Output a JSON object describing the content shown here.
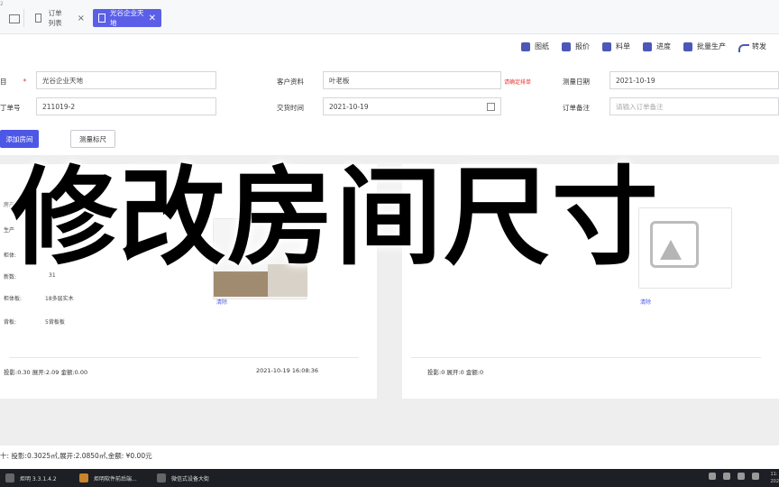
{
  "window": {
    "corner_glyph": "2"
  },
  "tabs": [
    {
      "label": "订单列表",
      "close": "×"
    },
    {
      "label": "光谷企业天地",
      "close": "✕"
    }
  ],
  "toolbar": [
    {
      "label": "图纸",
      "icon": "drawing-icon"
    },
    {
      "label": "报价",
      "icon": "quote-icon"
    },
    {
      "label": "料单",
      "icon": "material-list-icon"
    },
    {
      "label": "进度",
      "icon": "progress-icon"
    },
    {
      "label": "批量生产",
      "icon": "batch-production-icon"
    },
    {
      "label": "转发",
      "icon": "forward-icon"
    }
  ],
  "form": {
    "project_label": "目",
    "required_mark": "*",
    "project_value": "光谷企业天地",
    "customer_label": "客户资料",
    "customer_value": "叶老板",
    "customer_warning": "请确定排单",
    "measure_date_label": "测量日期",
    "measure_date_value": "2021-10-19",
    "order_no_label": "丁单号",
    "order_no_value": "211019-2",
    "delivery_label": "交货时间",
    "delivery_value": "2021-10-19",
    "remark_label": "订单备注",
    "remark_placeholder": "请输入订单备注"
  },
  "actions": {
    "add_room": "添加房间",
    "measure_ruler": "测量标尺"
  },
  "cards": {
    "left": {
      "rows": [
        {
          "label": "房产"
        },
        {
          "label": "生产"
        },
        {
          "label": "柜体:"
        },
        {
          "label": "新数:",
          "value": "31"
        },
        {
          "label": "柜体板:",
          "value": "18多层实木"
        },
        {
          "label": "背板:",
          "value": "5背板板"
        }
      ],
      "delete_link": "清除",
      "footer_stats": "投影:0.30   展开:2.09   金额:0.00",
      "footer_time": "2021-10-19 16:08:36"
    },
    "right": {
      "delete_link": "清除",
      "footer_stats": "投影:0   展开:0   金额:0"
    }
  },
  "overlay_caption": "修改房间尺寸",
  "summary": "十: 投影:0.3025㎡,展开:2.0850㎡,金额: ¥0.00元",
  "taskbar": [
    {
      "label": "炬明   3.3.1.4.2"
    },
    {
      "label": "炬明软件前后端..."
    },
    {
      "label": "微信式设备大街"
    }
  ],
  "clock": {
    "time": "11:",
    "date": "202"
  }
}
